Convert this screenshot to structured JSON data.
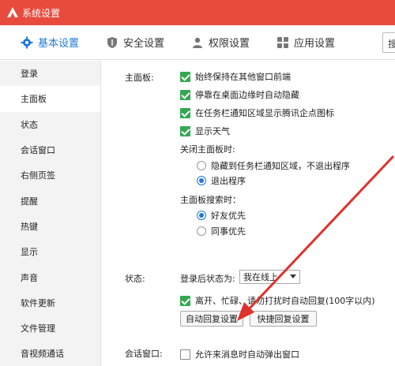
{
  "window": {
    "title": "系统设置"
  },
  "tabs": [
    {
      "label": "基本设置",
      "icon": "gear-icon"
    },
    {
      "label": "安全设置",
      "icon": "shield-icon"
    },
    {
      "label": "权限设置",
      "icon": "person-icon"
    },
    {
      "label": "应用设置",
      "icon": "grid-icon"
    }
  ],
  "search": {
    "label": "搜"
  },
  "sidebar": {
    "items": [
      {
        "label": "登录"
      },
      {
        "label": "主面板"
      },
      {
        "label": "状态"
      },
      {
        "label": "会话窗口"
      },
      {
        "label": "右侧页签"
      },
      {
        "label": "提醒"
      },
      {
        "label": "热键"
      },
      {
        "label": "显示"
      },
      {
        "label": "声音"
      },
      {
        "label": "软件更新"
      },
      {
        "label": "文件管理"
      },
      {
        "label": "音视频通话"
      }
    ]
  },
  "main_panel": {
    "section_label": "主面板:",
    "options": [
      {
        "label": "始终保持在其他窗口前端",
        "checked": true
      },
      {
        "label": "停靠在桌面边缘时自动隐藏",
        "checked": true
      },
      {
        "label": "在任务栏通知区域显示腾讯企点图标",
        "checked": true
      },
      {
        "label": "显示天气",
        "checked": true
      }
    ],
    "close_label": "关闭主面板时:",
    "close_options": [
      {
        "label": "隐藏到任务栏通知区域，不退出程序",
        "selected": false
      },
      {
        "label": "退出程序",
        "selected": true
      }
    ],
    "search_label": "主面板搜索时：",
    "search_options": [
      {
        "label": "好友优先",
        "selected": true
      },
      {
        "label": "同事优先",
        "selected": false
      }
    ]
  },
  "status": {
    "section_label": "状态:",
    "login_status_label": "登录后状态为:",
    "login_status_value": "我在线上",
    "auto_reply_label": "离开、忙碌、请勿打扰时自动回复(100字以内)",
    "auto_reply_checked": true,
    "auto_reply_button": "自动回复设置",
    "quick_reply_button": "快捷回复设置"
  },
  "chat_window": {
    "section_label": "会话窗口:",
    "popup_label": "允许来消息时自动弹出窗口",
    "popup_checked": false
  },
  "colors": {
    "titlebar": "#e84a3c",
    "accent": "#1e79d6",
    "check": "#33a852",
    "annotation_arrow": "#e0312c"
  }
}
